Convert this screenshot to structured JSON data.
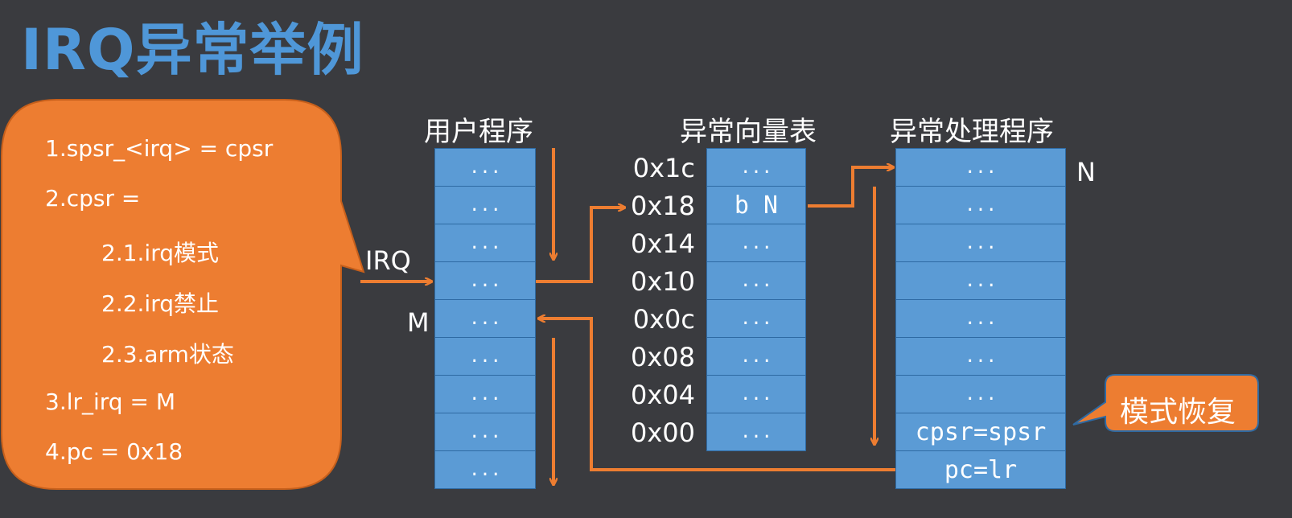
{
  "title": "IRQ异常举例",
  "steps": [
    "1.spsr_<irq> = cpsr",
    "2.cpsr =",
    "2.1.irq模式",
    "2.2.irq禁止",
    "2.3.arm状态",
    "3.lr_irq = M",
    "4.pc = 0x18"
  ],
  "columns": {
    "user_program": "用户程序",
    "vector_table": "异常向量表",
    "handler": "异常处理程序"
  },
  "user_cells": [
    "...",
    "...",
    "...",
    "...",
    "...",
    "...",
    "...",
    "...",
    "..."
  ],
  "vector_addresses": [
    "0x1c",
    "0x18",
    "0x14",
    "0x10",
    "0x0c",
    "0x08",
    "0x04",
    "0x00"
  ],
  "vector_cells": [
    "...",
    "b N",
    "...",
    "...",
    "...",
    "...",
    "...",
    "..."
  ],
  "handler_cells": [
    "...",
    "...",
    "...",
    "...",
    "...",
    "...",
    "...",
    "cpsr=spsr",
    "pc=lr"
  ],
  "labels": {
    "irq": "IRQ",
    "m": "M",
    "n": "N",
    "restore": "模式恢复"
  },
  "colors": {
    "background": "#3a3b3f",
    "title": "#4f97d8",
    "callout": "#ed7d31",
    "cell": "#5b9bd5",
    "arrow": "#ed7d31"
  }
}
